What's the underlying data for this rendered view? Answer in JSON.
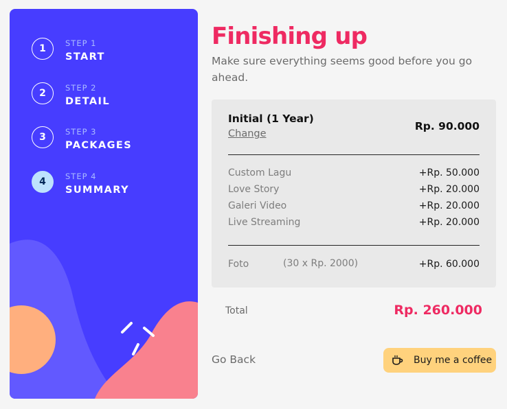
{
  "sidebar": {
    "steps": [
      {
        "number": "1",
        "label": "STEP 1",
        "title": "START",
        "active": false
      },
      {
        "number": "2",
        "label": "STEP 2",
        "title": "DETAIL",
        "active": false
      },
      {
        "number": "3",
        "label": "STEP 3",
        "title": "PACKAGES",
        "active": false
      },
      {
        "number": "4",
        "label": "STEP 4",
        "title": "SUMMARY",
        "active": true
      }
    ]
  },
  "main": {
    "title": "Finishing up",
    "subtitle": "Make sure everything seems good before you go ahead.",
    "plan": {
      "name": "Initial (1 Year)",
      "change_label": "Change",
      "price": "Rp. 90.000"
    },
    "addons": [
      {
        "name": "Custom Lagu",
        "price": "+Rp. 50.000"
      },
      {
        "name": "Love Story",
        "price": "+Rp. 20.000"
      },
      {
        "name": "Galeri Video",
        "price": "+Rp. 20.000"
      },
      {
        "name": "Live Streaming",
        "price": "+Rp. 20.000"
      }
    ],
    "foto": {
      "name": "Foto",
      "quantity": "(30 x Rp. 2000)",
      "price": "+Rp. 60.000"
    },
    "total": {
      "label": "Total",
      "value": "Rp. 260.000"
    },
    "go_back_label": "Go Back",
    "coffee_button": {
      "label": "Buy me a coffee",
      "icon": "coffee-cup-icon"
    }
  },
  "colors": {
    "sidebar_bg": "#473dff",
    "accent": "#ee2a62",
    "active_step": "#bee2fd",
    "coffee_button": "#ffd27d"
  }
}
